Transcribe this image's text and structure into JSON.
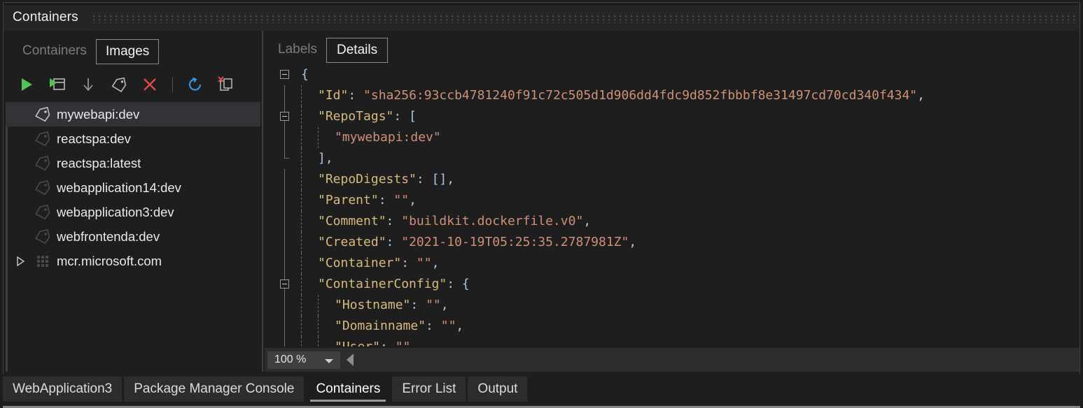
{
  "window": {
    "panel_title": "Containers",
    "accent_color": "#7160e8"
  },
  "left_panel": {
    "tabs": [
      {
        "label": "Containers",
        "active": false
      },
      {
        "label": "Images",
        "active": true
      }
    ],
    "toolbar": [
      {
        "name": "run-icon",
        "title": "Run"
      },
      {
        "name": "run-interactive-icon",
        "title": "Run Interactive"
      },
      {
        "name": "pull-icon",
        "title": "Pull"
      },
      {
        "name": "tag-icon",
        "title": "Tag"
      },
      {
        "name": "remove-icon",
        "title": "Remove"
      },
      {
        "name": "separator",
        "title": ""
      },
      {
        "name": "refresh-icon",
        "title": "Refresh"
      },
      {
        "name": "prune-icon",
        "title": "Prune"
      }
    ],
    "images": [
      {
        "label": "mywebapi:dev",
        "icon": "tag-icon",
        "selected": true,
        "expandable": false
      },
      {
        "label": "reactspa:dev",
        "icon": "tag-icon",
        "selected": false,
        "expandable": false
      },
      {
        "label": "reactspa:latest",
        "icon": "tag-icon",
        "selected": false,
        "expandable": false
      },
      {
        "label": "webapplication14:dev",
        "icon": "tag-icon",
        "selected": false,
        "expandable": false
      },
      {
        "label": "webapplication3:dev",
        "icon": "tag-icon",
        "selected": false,
        "expandable": false
      },
      {
        "label": "webfrontenda:dev",
        "icon": "tag-icon",
        "selected": false,
        "expandable": false
      },
      {
        "label": "mcr.microsoft.com",
        "icon": "registry-icon",
        "selected": false,
        "expandable": true
      }
    ]
  },
  "right_panel": {
    "tabs": [
      {
        "label": "Labels",
        "active": false
      },
      {
        "label": "Details",
        "active": true
      }
    ],
    "json_lines": [
      {
        "indent": 0,
        "collapse": true,
        "text": "{",
        "parts": [
          {
            "t": "{",
            "c": "p"
          }
        ]
      },
      {
        "indent": 1,
        "collapse": false,
        "parts": [
          {
            "t": "\"Id\"",
            "c": "k"
          },
          {
            "t": ": ",
            "c": "p"
          },
          {
            "t": "\"sha256:93ccb4781240f91c72c505d1d906dd4fdc9d852fbbbf8e31497cd70cd340f434\"",
            "c": "s"
          },
          {
            "t": ",",
            "c": "p"
          }
        ]
      },
      {
        "indent": 1,
        "collapse": true,
        "parts": [
          {
            "t": "\"RepoTags\"",
            "c": "k"
          },
          {
            "t": ": [",
            "c": "p"
          }
        ]
      },
      {
        "indent": 2,
        "collapse": false,
        "parts": [
          {
            "t": "\"mywebapi:dev\"",
            "c": "s"
          }
        ]
      },
      {
        "indent": 1,
        "collapse": false,
        "parts": [
          {
            "t": "],",
            "c": "p"
          }
        ]
      },
      {
        "indent": 1,
        "collapse": false,
        "parts": [
          {
            "t": "\"RepoDigests\"",
            "c": "k"
          },
          {
            "t": ": [],",
            "c": "p"
          }
        ]
      },
      {
        "indent": 1,
        "collapse": false,
        "parts": [
          {
            "t": "\"Parent\"",
            "c": "k"
          },
          {
            "t": ": ",
            "c": "p"
          },
          {
            "t": "\"\"",
            "c": "s"
          },
          {
            "t": ",",
            "c": "p"
          }
        ]
      },
      {
        "indent": 1,
        "collapse": false,
        "parts": [
          {
            "t": "\"Comment\"",
            "c": "k"
          },
          {
            "t": ": ",
            "c": "p"
          },
          {
            "t": "\"buildkit.dockerfile.v0\"",
            "c": "s"
          },
          {
            "t": ",",
            "c": "p"
          }
        ]
      },
      {
        "indent": 1,
        "collapse": false,
        "parts": [
          {
            "t": "\"Created\"",
            "c": "k"
          },
          {
            "t": ": ",
            "c": "p"
          },
          {
            "t": "\"2021-10-19T05:25:35.2787981Z\"",
            "c": "s"
          },
          {
            "t": ",",
            "c": "p"
          }
        ]
      },
      {
        "indent": 1,
        "collapse": false,
        "parts": [
          {
            "t": "\"Container\"",
            "c": "k"
          },
          {
            "t": ": ",
            "c": "p"
          },
          {
            "t": "\"\"",
            "c": "s"
          },
          {
            "t": ",",
            "c": "p"
          }
        ]
      },
      {
        "indent": 1,
        "collapse": true,
        "parts": [
          {
            "t": "\"ContainerConfig\"",
            "c": "k"
          },
          {
            "t": ": {",
            "c": "p"
          }
        ]
      },
      {
        "indent": 2,
        "collapse": false,
        "parts": [
          {
            "t": "\"Hostname\"",
            "c": "k"
          },
          {
            "t": ": ",
            "c": "p"
          },
          {
            "t": "\"\"",
            "c": "s"
          },
          {
            "t": ",",
            "c": "p"
          }
        ]
      },
      {
        "indent": 2,
        "collapse": false,
        "parts": [
          {
            "t": "\"Domainname\"",
            "c": "k"
          },
          {
            "t": ": ",
            "c": "p"
          },
          {
            "t": "\"\"",
            "c": "s"
          },
          {
            "t": ",",
            "c": "p"
          }
        ]
      },
      {
        "indent": 2,
        "collapse": false,
        "parts": [
          {
            "t": "\"User\"",
            "c": "k"
          },
          {
            "t": ": ",
            "c": "p"
          },
          {
            "t": "\"\"",
            "c": "s"
          },
          {
            "t": ",",
            "c": "p"
          }
        ]
      }
    ],
    "zoom_level": "100 %"
  },
  "bottom_tabs": [
    {
      "label": "WebApplication3",
      "active": false
    },
    {
      "label": "Package Manager Console",
      "active": false
    },
    {
      "label": "Containers",
      "active": true
    },
    {
      "label": "Error List",
      "active": false
    },
    {
      "label": "Output",
      "active": false
    }
  ]
}
